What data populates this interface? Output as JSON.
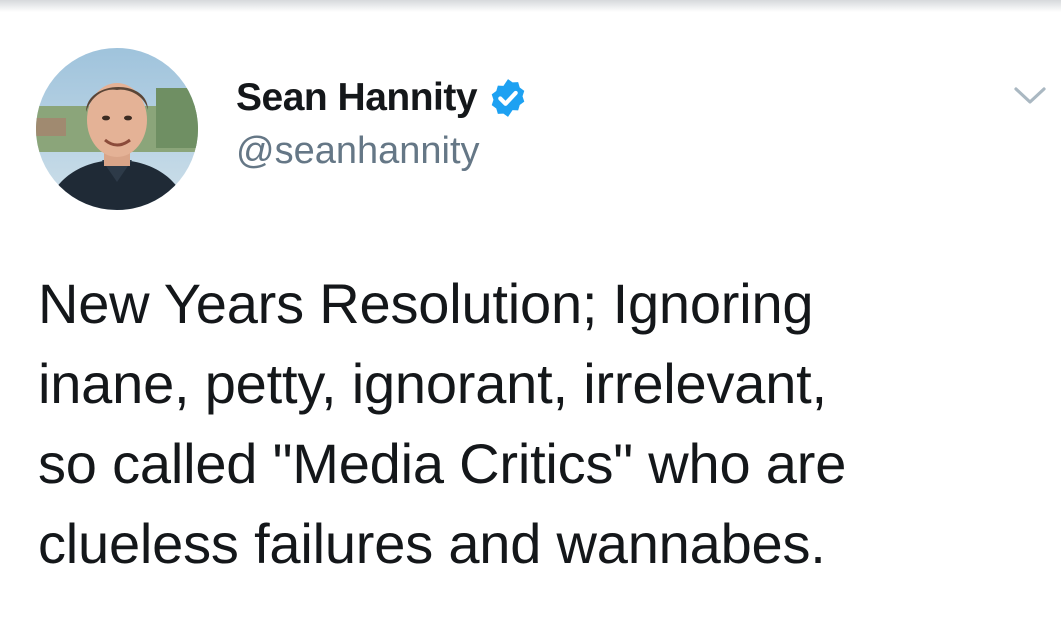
{
  "tweet": {
    "author": {
      "display_name": "Sean Hannity",
      "handle": "@seanhannity",
      "verified": true,
      "avatar_icon": "profile-photo"
    },
    "menu_icon": "chevron-down-icon",
    "text_lines": [
      "New Years Resolution;  Ignoring",
      "inane, petty, ignorant, irrelevant,",
      "so called \"Media Critics\" who are",
      "clueless failures and wannabes."
    ]
  },
  "colors": {
    "text": "#14171a",
    "handle": "#657786",
    "verified": "#1da1f2",
    "caret": "#aab8c2"
  }
}
